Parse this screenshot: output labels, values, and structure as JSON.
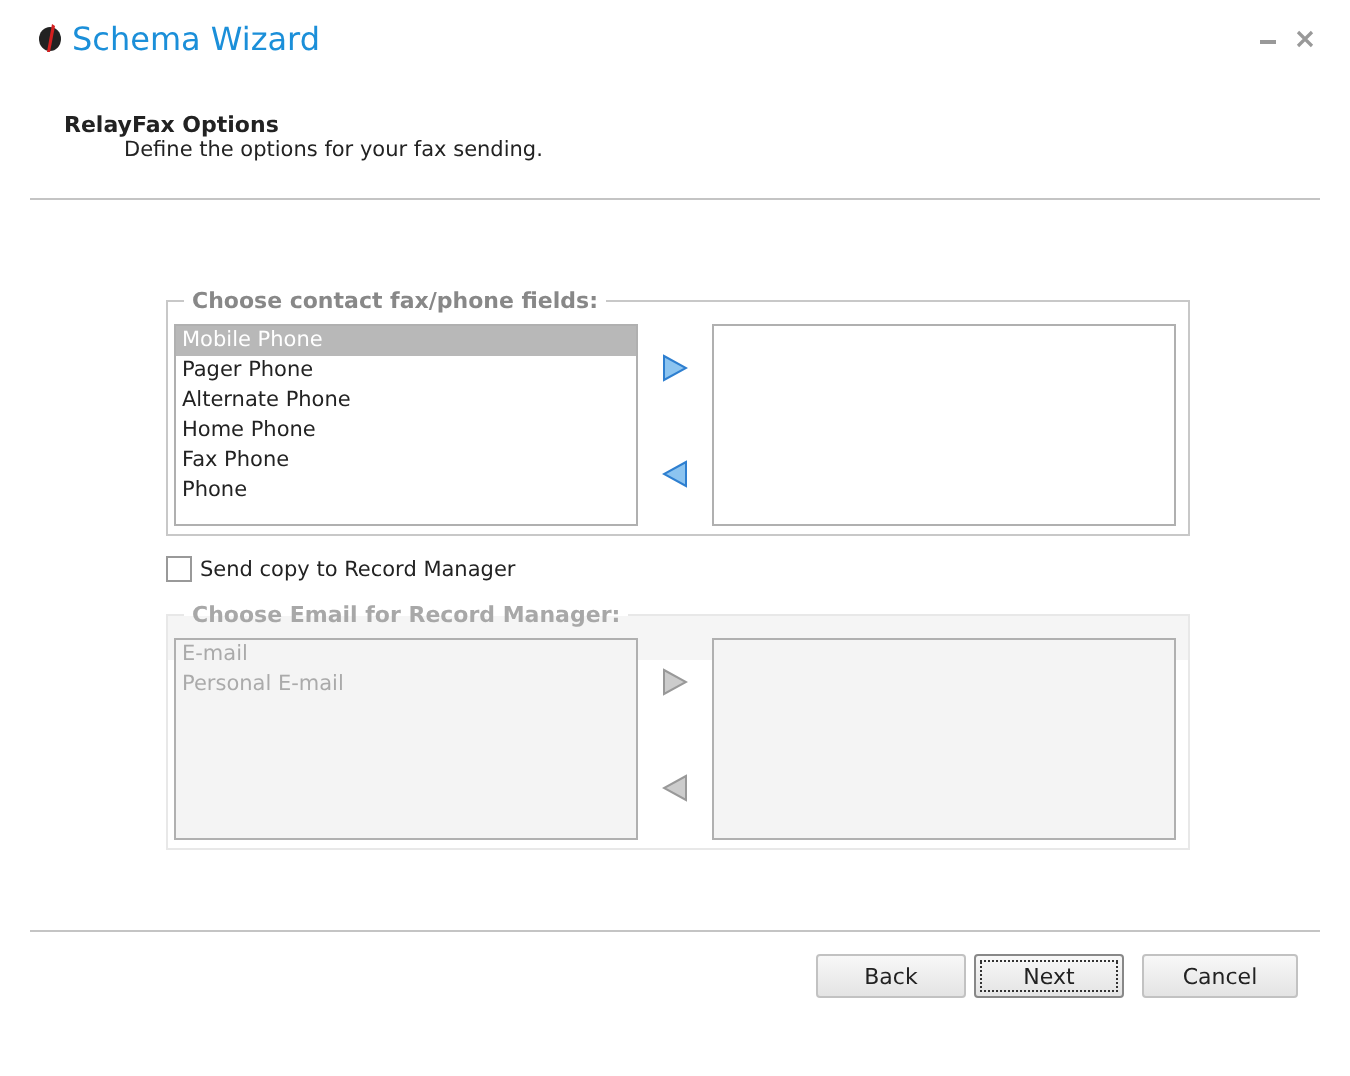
{
  "window": {
    "title": "Schema Wizard"
  },
  "page": {
    "title": "RelayFax Options",
    "subtitle": "Define the options for your fax sending."
  },
  "phone_group": {
    "legend": "Choose contact fax/phone fields:",
    "disabled": false,
    "available": [
      {
        "label": "Mobile Phone",
        "selected": true
      },
      {
        "label": "Pager Phone",
        "selected": false
      },
      {
        "label": "Alternate Phone",
        "selected": false
      },
      {
        "label": "Home Phone",
        "selected": false
      },
      {
        "label": "Fax Phone",
        "selected": false
      },
      {
        "label": "Phone",
        "selected": false
      }
    ]
  },
  "send_copy": {
    "label": "Send copy to Record Manager",
    "checked": false
  },
  "email_group": {
    "legend": "Choose Email for Record Manager:",
    "disabled": true,
    "available": [
      {
        "label": "E-mail",
        "selected": false
      },
      {
        "label": "Personal E-mail",
        "selected": false
      }
    ]
  },
  "buttons": [
    {
      "label": "Back",
      "focused": false
    },
    {
      "label": "Next",
      "focused": true
    },
    {
      "label": "Cancel",
      "focused": false
    }
  ]
}
